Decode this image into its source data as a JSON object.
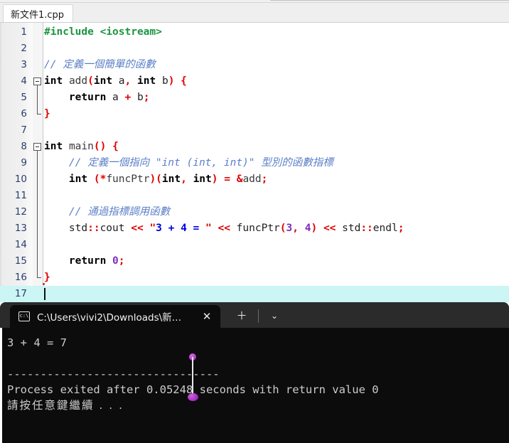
{
  "editor": {
    "tab": {
      "label": "新文件1.cpp"
    },
    "lines": [
      {
        "n": "1",
        "tokens": [
          {
            "t": "#include <iostream>",
            "c": "pp"
          }
        ]
      },
      {
        "n": "2",
        "tokens": []
      },
      {
        "n": "3",
        "tokens": [
          {
            "t": "// 定義一個簡單的函數",
            "c": "cmt"
          }
        ]
      },
      {
        "n": "4",
        "tokens": [
          {
            "t": "int",
            "c": "kw"
          },
          {
            "t": " ",
            "c": "id"
          },
          {
            "t": "add",
            "c": "idg"
          },
          {
            "t": "(",
            "c": "op"
          },
          {
            "t": "int",
            "c": "kw"
          },
          {
            "t": " a",
            "c": "id"
          },
          {
            "t": ",",
            "c": "op"
          },
          {
            "t": " ",
            "c": "id"
          },
          {
            "t": "int",
            "c": "kw"
          },
          {
            "t": " b",
            "c": "id"
          },
          {
            "t": ")",
            "c": "op"
          },
          {
            "t": " ",
            "c": "id"
          },
          {
            "t": "{",
            "c": "op"
          }
        ]
      },
      {
        "n": "5",
        "tokens": [
          {
            "t": "    ",
            "c": "id"
          },
          {
            "t": "return",
            "c": "kw"
          },
          {
            "t": " a ",
            "c": "id"
          },
          {
            "t": "+",
            "c": "op"
          },
          {
            "t": " b",
            "c": "id"
          },
          {
            "t": ";",
            "c": "op"
          }
        ]
      },
      {
        "n": "6",
        "tokens": [
          {
            "t": "}",
            "c": "op"
          }
        ]
      },
      {
        "n": "7",
        "tokens": []
      },
      {
        "n": "8",
        "tokens": [
          {
            "t": "int",
            "c": "kw"
          },
          {
            "t": " ",
            "c": "id"
          },
          {
            "t": "main",
            "c": "idg"
          },
          {
            "t": "()",
            "c": "op"
          },
          {
            "t": " ",
            "c": "id"
          },
          {
            "t": "{",
            "c": "op"
          }
        ]
      },
      {
        "n": "9",
        "tokens": [
          {
            "t": "    // 定義一個指向 \"int (int, int)\" 型別的函數指標",
            "c": "cmt"
          }
        ]
      },
      {
        "n": "10",
        "tokens": [
          {
            "t": "    ",
            "c": "id"
          },
          {
            "t": "int",
            "c": "kw"
          },
          {
            "t": " ",
            "c": "id"
          },
          {
            "t": "(*",
            "c": "op"
          },
          {
            "t": "funcPtr",
            "c": "idg"
          },
          {
            "t": ")(",
            "c": "op"
          },
          {
            "t": "int",
            "c": "kw"
          },
          {
            "t": ",",
            "c": "op"
          },
          {
            "t": " ",
            "c": "id"
          },
          {
            "t": "int",
            "c": "kw"
          },
          {
            "t": ")",
            "c": "op"
          },
          {
            "t": " ",
            "c": "id"
          },
          {
            "t": "=",
            "c": "op"
          },
          {
            "t": " ",
            "c": "id"
          },
          {
            "t": "&",
            "c": "op"
          },
          {
            "t": "add",
            "c": "idg"
          },
          {
            "t": ";",
            "c": "op"
          }
        ]
      },
      {
        "n": "11",
        "tokens": []
      },
      {
        "n": "12",
        "tokens": [
          {
            "t": "    // 通過指標調用函數",
            "c": "cmt"
          }
        ]
      },
      {
        "n": "13",
        "tokens": [
          {
            "t": "    std",
            "c": "id"
          },
          {
            "t": "::",
            "c": "op"
          },
          {
            "t": "cout ",
            "c": "id"
          },
          {
            "t": "<<",
            "c": "op"
          },
          {
            "t": " ",
            "c": "id"
          },
          {
            "t": "\"",
            "c": "strq"
          },
          {
            "t": "3 + 4 = ",
            "c": "str"
          },
          {
            "t": "\"",
            "c": "strq"
          },
          {
            "t": " ",
            "c": "id"
          },
          {
            "t": "<<",
            "c": "op"
          },
          {
            "t": " funcPtr",
            "c": "id"
          },
          {
            "t": "(",
            "c": "op"
          },
          {
            "t": "3",
            "c": "num"
          },
          {
            "t": ",",
            "c": "op"
          },
          {
            "t": " ",
            "c": "id"
          },
          {
            "t": "4",
            "c": "num"
          },
          {
            "t": ")",
            "c": "op"
          },
          {
            "t": " ",
            "c": "id"
          },
          {
            "t": "<<",
            "c": "op"
          },
          {
            "t": " std",
            "c": "id"
          },
          {
            "t": "::",
            "c": "op"
          },
          {
            "t": "endl",
            "c": "id"
          },
          {
            "t": ";",
            "c": "op"
          }
        ]
      },
      {
        "n": "14",
        "tokens": []
      },
      {
        "n": "15",
        "tokens": [
          {
            "t": "    ",
            "c": "id"
          },
          {
            "t": "return",
            "c": "kw"
          },
          {
            "t": " ",
            "c": "id"
          },
          {
            "t": "0",
            "c": "num"
          },
          {
            "t": ";",
            "c": "op"
          }
        ]
      },
      {
        "n": "16",
        "tokens": [
          {
            "t": "}",
            "c": "op"
          }
        ]
      },
      {
        "n": "17",
        "tokens": []
      }
    ],
    "folds": [
      {
        "start": 4,
        "end": 6
      },
      {
        "start": 8,
        "end": 16
      }
    ],
    "current_line": 17
  },
  "terminal": {
    "tab": {
      "title": "C:\\Users\\vivi2\\Downloads\\新…",
      "icon": "c:\\"
    },
    "close_label": "✕",
    "newtab_label": "＋",
    "dropdown_label": "⌄",
    "output": [
      {
        "text": "3 + 4 = 7",
        "cjk": false
      },
      {
        "text": "",
        "cjk": false
      },
      {
        "text": "--------------------------------",
        "cjk": false
      },
      {
        "text": "Process exited after 0.05248 seconds with return value 0",
        "cjk": false
      },
      {
        "text": "請按任意鍵繼續 . . .",
        "cjk": true
      }
    ]
  },
  "colors": {
    "editor_bg": "#ffffff",
    "gutter_bg": "#eeeeee",
    "current_line": "#ccf5f5",
    "terminal_bg": "#0c0c0c",
    "terminal_fg": "#cccccc",
    "keyword": "#000000",
    "preproc": "#1a9641",
    "string": "#0000e0",
    "operator": "#e00000",
    "number": "#7b2fbe",
    "comment": "#5b7fc7",
    "linenumber": "#2b3f6b",
    "cursor_marker": "#9a18b8"
  }
}
